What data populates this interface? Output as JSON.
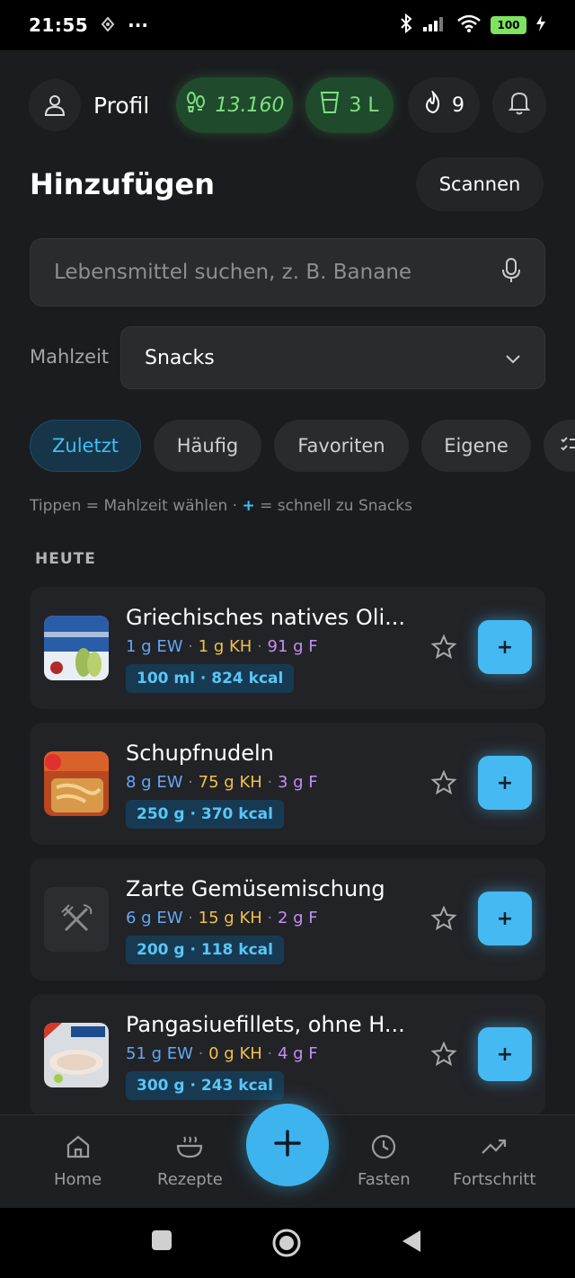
{
  "status_bar": {
    "time": "21:55",
    "dots": "···",
    "battery": "100"
  },
  "top_bar": {
    "profile_label": "Profil",
    "steps_value": "13.160",
    "water_value": "3 L",
    "streak_value": "9"
  },
  "header": {
    "title": "Hinzufügen",
    "scan_label": "Scannen"
  },
  "search": {
    "placeholder": "Lebensmittel suchen, z. B. Banane"
  },
  "meal": {
    "label": "Mahlzeit",
    "selected": "Snacks"
  },
  "tabs": [
    {
      "label": "Zuletzt",
      "active": true
    },
    {
      "label": "Häufig",
      "active": false
    },
    {
      "label": "Favoriten",
      "active": false
    },
    {
      "label": "Eigene",
      "active": false
    }
  ],
  "hint": {
    "part1": "Tippen = Mahlzeit wählen · ",
    "plus": "+",
    "part2": " = schnell zu Snacks"
  },
  "section": {
    "title": "HEUTE"
  },
  "foods": [
    {
      "name": "Griechisches natives Oli...",
      "ew": "1 g EW",
      "kh": "1 g KH",
      "f": "91 g F",
      "portion": "100 ml · 824 kcal",
      "thumb": "olive-oil"
    },
    {
      "name": "Schupfnudeln",
      "ew": "8 g EW",
      "kh": "75 g KH",
      "f": "3 g F",
      "portion": "250 g · 370 kcal",
      "thumb": "noodles"
    },
    {
      "name": "Zarte Gemüsemischung",
      "ew": "6 g EW",
      "kh": "15 g KH",
      "f": "2 g F",
      "portion": "200 g · 118 kcal",
      "thumb": "placeholder"
    },
    {
      "name": "Pangasiuefillets, ohne H...",
      "ew": "51 g EW",
      "kh": "0 g KH",
      "f": "4 g F",
      "portion": "300 g · 243 kcal",
      "thumb": "fish"
    }
  ],
  "add_label": "+",
  "dot": " · ",
  "bottom_nav": {
    "home": "Home",
    "recipes": "Rezepte",
    "fasting": "Fasten",
    "progress": "Fortschritt"
  },
  "colors": {
    "accent": "#3ec0f5",
    "green": "#7ee081",
    "protein": "#63a8f5",
    "carbs": "#f0c14b",
    "fat": "#c38ff2"
  }
}
